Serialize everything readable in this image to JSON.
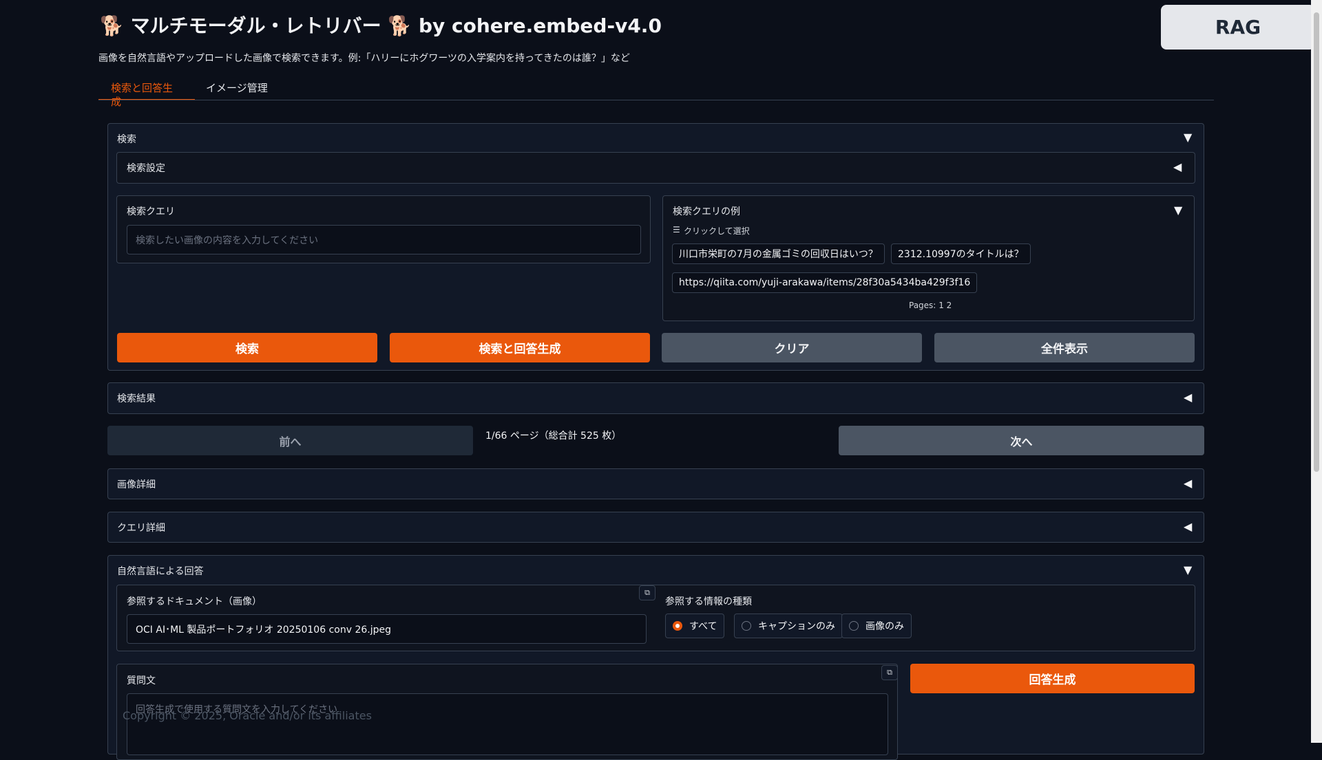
{
  "header": {
    "title": "🐕 マルチモーダル・レトリバー 🐕 by cohere.embed-v4.0",
    "subtitle": "画像を自然言語やアップロードした画像で検索できます。例:「ハリーにホグワーツの入学案内を持ってきたのは誰？」など",
    "rag_button": "RAG"
  },
  "tabs": [
    {
      "label": "検索と回答生成",
      "active": true
    },
    {
      "label": "イメージ管理",
      "active": false
    }
  ],
  "search_section": {
    "title": "検索",
    "settings_title": "検索設定",
    "query_label": "検索クエリ",
    "query_placeholder": "検索したい画像の内容を入力してください",
    "examples": {
      "title": "検索クエリの例",
      "hint": "クリックして選択",
      "items": [
        "川口市栄町の7月の金属ゴミの回収日はいつ？",
        "2312.10997のタイトルは？",
        "https://qiita.com/yuji-arakawa/items/28f30a5434ba429f3f16"
      ],
      "pages_label": "Pages:",
      "page1": "1",
      "page2": "2"
    },
    "buttons": {
      "search": "検索",
      "search_and_answer": "検索と回答生成",
      "clear": "クリア",
      "show_all": "全件表示"
    }
  },
  "results": {
    "title": "検索結果",
    "prev": "前へ",
    "page_info": "1/66 ページ（総合計 525 枚）",
    "next": "次へ"
  },
  "image_details": {
    "title": "画像詳細"
  },
  "query_details": {
    "title": "クエリ詳細"
  },
  "answer_section": {
    "title": "自然言語による回答",
    "ref_doc_label": "参照するドキュメント（画像）",
    "ref_doc_value": "OCI AI･ML 製品ポートフォリオ 20250106 conv 26.jpeg",
    "info_type_label": "参照する情報の種類",
    "info_type_options": [
      "すべて",
      "キャプションのみ",
      "画像のみ"
    ],
    "info_type_selected": "すべて",
    "question_label": "質問文",
    "question_placeholder": "回答生成で使用する質問文を入力してください",
    "generate_button": "回答生成"
  },
  "footer": {
    "copyright": "Copyright © 2025, Oracle and/or its affiliates"
  },
  "icons": {
    "collapse": "▼",
    "expand": "◀",
    "copy": "⧉",
    "list": "☰"
  },
  "colors": {
    "accent": "#ea580c",
    "background": "#0b0f19",
    "panel": "#111827",
    "secondary_button": "#4b5563"
  }
}
